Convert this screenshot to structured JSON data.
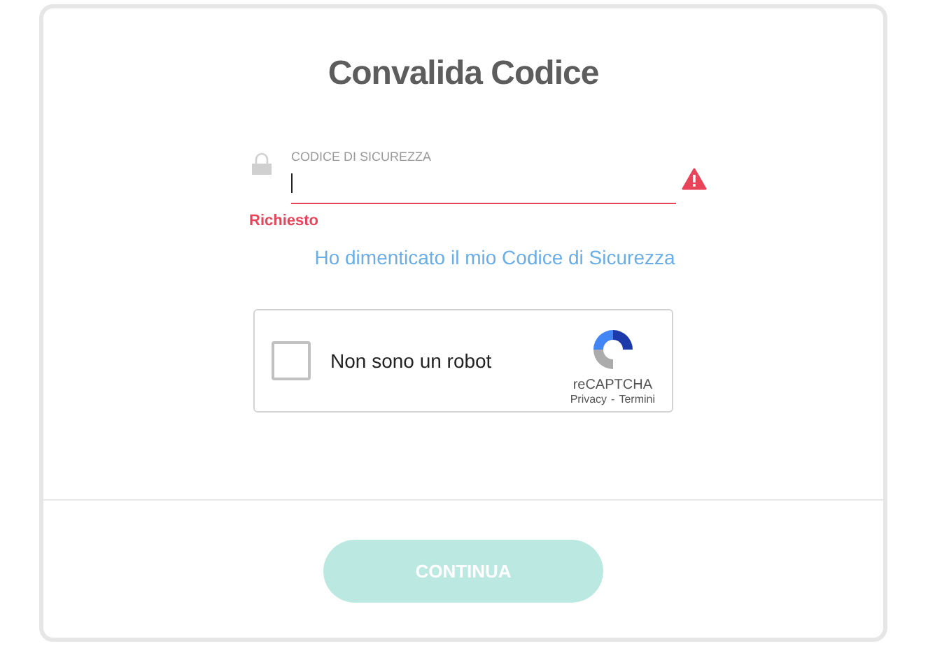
{
  "title": "Convalida Codice",
  "field": {
    "label": "CODICE DI SICUREZZA",
    "focused": true,
    "invalid": true,
    "error": "Richiesto"
  },
  "forgot_link": "Ho dimenticato il mio Codice di Sicurezza",
  "captcha": {
    "label": "Non sono un robot",
    "checked": false,
    "brand": "reCAPTCHA",
    "links": [
      "Privacy",
      "Termini"
    ],
    "separator": "-"
  },
  "submit": {
    "label": "CONTINUA",
    "disabled": true
  }
}
